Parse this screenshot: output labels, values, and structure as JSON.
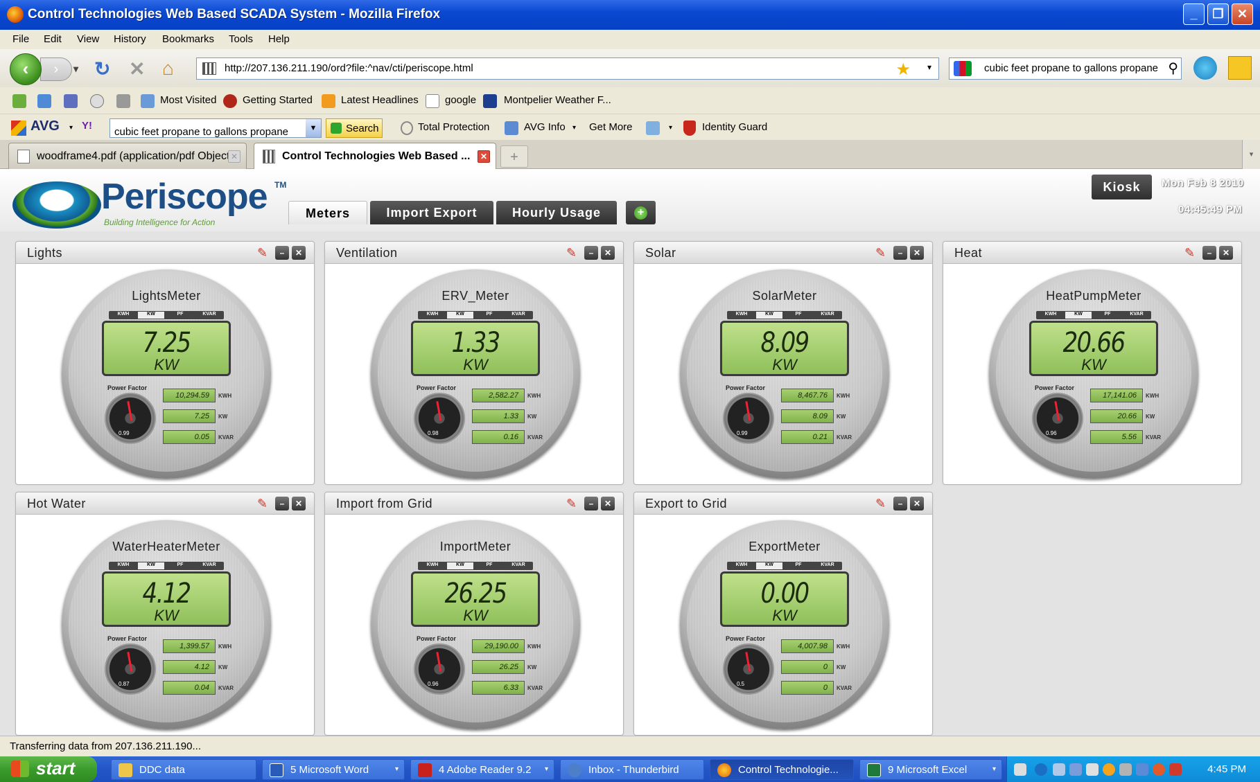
{
  "window": {
    "title": "Control Technologies Web Based SCADA System - Mozilla Firefox",
    "controls": [
      "_",
      "❐",
      "✕"
    ]
  },
  "menu": [
    "File",
    "Edit",
    "View",
    "History",
    "Bookmarks",
    "Tools",
    "Help"
  ],
  "nav": {
    "url": "http://207.136.211.190/ord?file:^nav/cti/periscope.html",
    "search_value": "cubic feet propane to gallons propane"
  },
  "bookmarks": [
    "Most Visited",
    "Getting Started",
    "Latest Headlines",
    "google",
    "Montpelier Weather F..."
  ],
  "avg": {
    "brand": "AVG",
    "search_value": "cubic feet propane to gallons propane",
    "search_label": "Search",
    "items": [
      "Total Protection",
      "AVG Info",
      "Get More",
      "Identity Guard"
    ]
  },
  "tabs": [
    {
      "label": "woodframe4.pdf (application/pdf Object)"
    },
    {
      "label": "Control Technologies Web Based ..."
    }
  ],
  "app": {
    "logo": {
      "name": "Periscope",
      "tm": "TM",
      "tagline": "Building Intelligence for Action"
    },
    "tabs": [
      "Meters",
      "Import Export",
      "Hourly Usage"
    ],
    "kiosk": "Kiosk",
    "date": "Mon Feb 8 2010",
    "time": "04:45:49 PM",
    "meter_modes": [
      "KWH",
      "KW",
      "PF",
      "KVAR"
    ],
    "power_factor_label": "Power Factor",
    "panels": [
      {
        "title": "Lights",
        "meter": "LightsMeter",
        "value": "7.25",
        "unit": "KW",
        "kwh": "10,294.59",
        "kw": "7.25",
        "kvar": "0.05",
        "pf": "0.99"
      },
      {
        "title": "Ventilation",
        "meter": "ERV_Meter",
        "value": "1.33",
        "unit": "KW",
        "kwh": "2,582.27",
        "kw": "1.33",
        "kvar": "0.16",
        "pf": "0.98"
      },
      {
        "title": "Solar",
        "meter": "SolarMeter",
        "value": "8.09",
        "unit": "KW",
        "kwh": "8,467.76",
        "kw": "8.09",
        "kvar": "0.21",
        "pf": "0.99"
      },
      {
        "title": "Heat",
        "meter": "HeatPumpMeter",
        "value": "20.66",
        "unit": "KW",
        "kwh": "17,141.06",
        "kw": "20.66",
        "kvar": "5.56",
        "pf": "0.96"
      },
      {
        "title": "Hot Water",
        "meter": "WaterHeaterMeter",
        "value": "4.12",
        "unit": "KW",
        "kwh": "1,399.57",
        "kw": "4.12",
        "kvar": "0.04",
        "pf": "0.87"
      },
      {
        "title": "Import from Grid",
        "meter": "ImportMeter",
        "value": "26.25",
        "unit": "KW",
        "kwh": "29,190.00",
        "kw": "26.25",
        "kvar": "6.33",
        "pf": "0.96"
      },
      {
        "title": "Export to Grid",
        "meter": "ExportMeter",
        "value": "0.00",
        "unit": "KW",
        "kwh": "4,007.98",
        "kw": "0",
        "kvar": "0",
        "pf": "0.5"
      }
    ],
    "small_units": [
      "KWH",
      "KW",
      "KVAR"
    ]
  },
  "status": "Transferring data from 207.136.211.190...",
  "taskbar": {
    "start": "start",
    "items": [
      "DDC data",
      "5 Microsoft Word",
      "4 Adobe Reader 9.2",
      "Inbox - Thunderbird",
      "Control Technologie...",
      "9 Microsoft Excel"
    ],
    "clock": "4:45 PM"
  }
}
